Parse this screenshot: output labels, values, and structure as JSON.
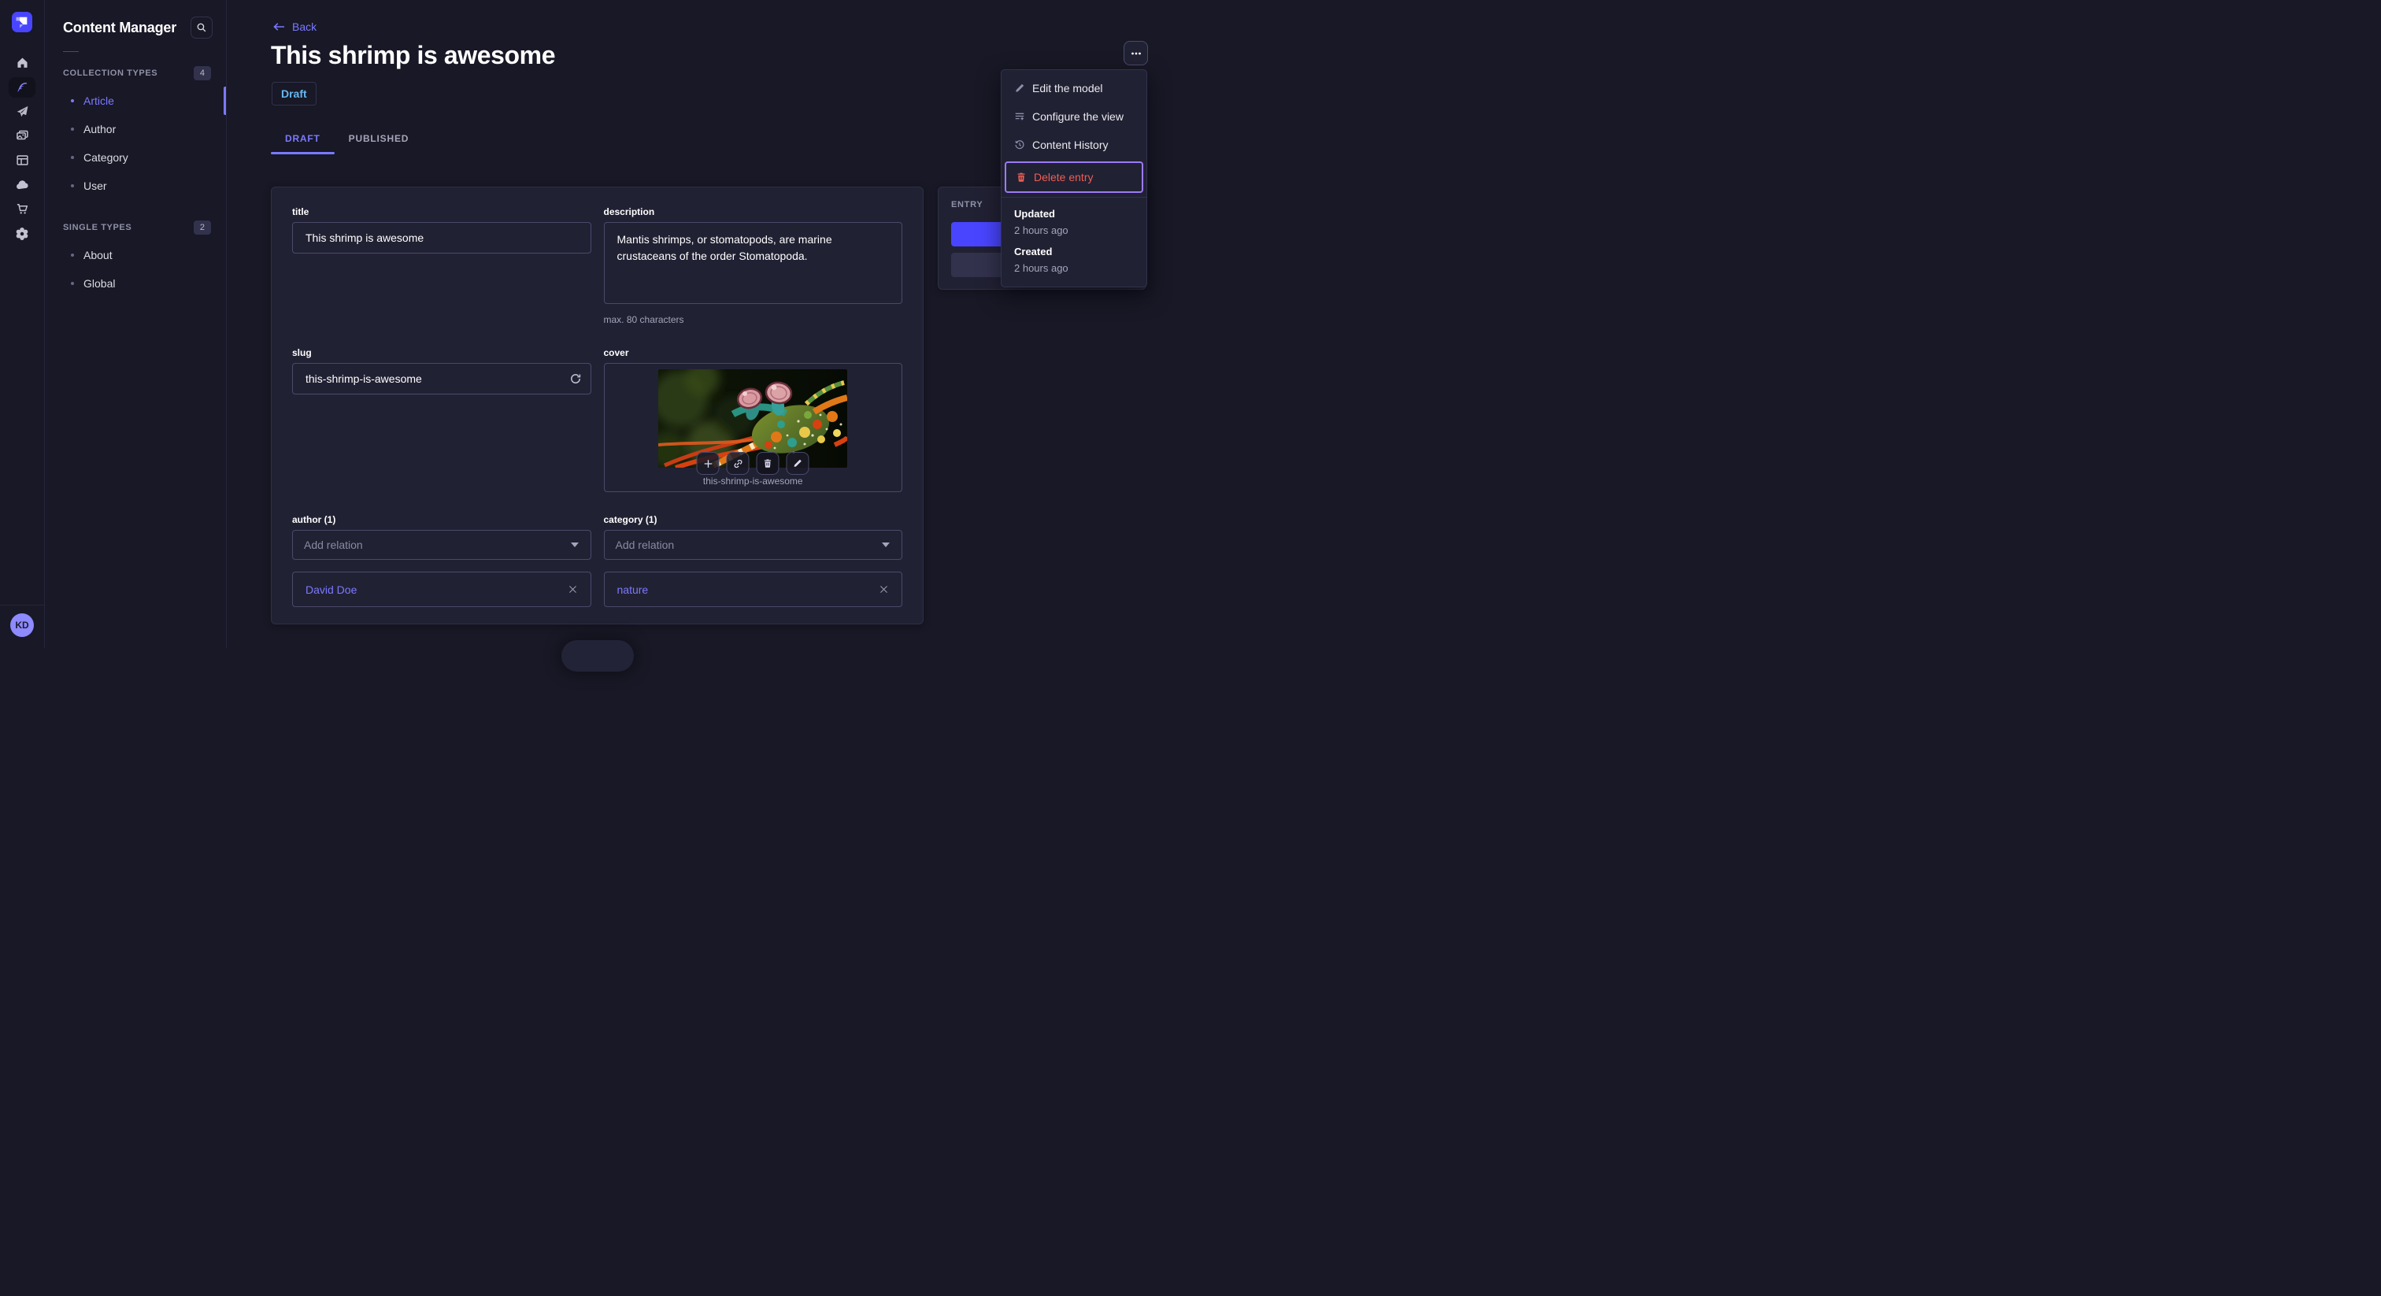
{
  "app": {
    "name": "Strapi"
  },
  "colors": {
    "background": "#181826",
    "surface": "#212134",
    "border": "#4a4a6a",
    "accent": "#4945ff",
    "link": "#7b79ff",
    "danger": "#ee5e52",
    "draft_status": "#66b7f1",
    "focus_outline": "#9c7bf5",
    "avatar_bg": "#8e8aff"
  },
  "rail": {
    "icons": [
      {
        "name": "home-icon"
      },
      {
        "name": "feather-icon",
        "active": true
      },
      {
        "name": "paper-plane-icon"
      },
      {
        "name": "media-library-icon"
      },
      {
        "name": "layout-icon"
      },
      {
        "name": "cloud-icon"
      },
      {
        "name": "cart-icon"
      },
      {
        "name": "gear-icon"
      }
    ],
    "avatar_initials": "KD"
  },
  "sidebar": {
    "title": "Content Manager",
    "search_icon": "search-icon",
    "sections": [
      {
        "label": "COLLECTION TYPES",
        "count": "4",
        "items": [
          {
            "label": "Article",
            "active": true
          },
          {
            "label": "Author"
          },
          {
            "label": "Category"
          },
          {
            "label": "User"
          }
        ]
      },
      {
        "label": "SINGLE TYPES",
        "count": "2",
        "items": [
          {
            "label": "About"
          },
          {
            "label": "Global"
          }
        ]
      }
    ]
  },
  "header": {
    "back_label": "Back",
    "title": "This shrimp is awesome",
    "status": "Draft",
    "tabs": [
      {
        "label": "DRAFT",
        "active": true
      },
      {
        "label": "PUBLISHED"
      }
    ],
    "more_button": "more-options"
  },
  "context_menu": {
    "items": [
      {
        "label": "Edit the model",
        "icon": "pencil-icon"
      },
      {
        "label": "Configure the view",
        "icon": "list-plus-icon"
      },
      {
        "label": "Content History",
        "icon": "history-icon"
      },
      {
        "label": "Delete entry",
        "icon": "trash-icon",
        "danger": true,
        "focused": true
      }
    ],
    "meta": {
      "updated_label": "Updated",
      "updated_value": "2 hours ago",
      "created_label": "Created",
      "created_value": "2 hours ago"
    }
  },
  "form": {
    "title": {
      "label": "title",
      "value": "This shrimp is awesome"
    },
    "description": {
      "label": "description",
      "value": "Mantis shrimps, or stomatopods, are marine crustaceans of the order Stomatopoda.",
      "hint": "max. 80 characters"
    },
    "slug": {
      "label": "slug",
      "value": "this-shrimp-is-awesome",
      "action_icon": "refresh-icon"
    },
    "cover": {
      "label": "cover",
      "caption": "this-shrimp-is-awesome",
      "actions": [
        "add-media",
        "copy-link",
        "delete-media",
        "edit-media"
      ]
    },
    "author": {
      "label": "author (1)",
      "placeholder": "Add relation",
      "relation": "David Doe"
    },
    "category": {
      "label": "category (1)",
      "placeholder": "Add relation",
      "relation": "nature"
    }
  },
  "entry_panel": {
    "title": "ENTRY"
  }
}
